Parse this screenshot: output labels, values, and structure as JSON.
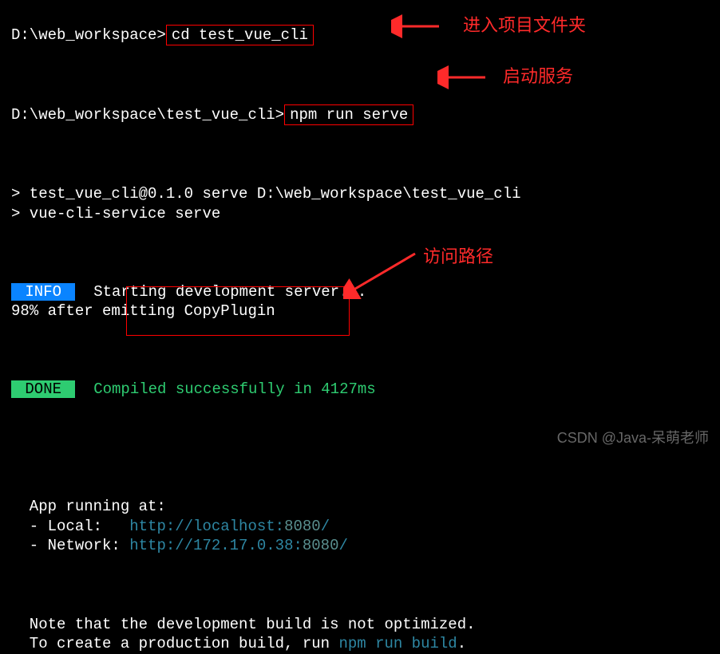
{
  "lines": {
    "l1_path": "D:\\web_workspace>",
    "l1_cmd": "cd test_vue_cli",
    "l2_path": "D:\\web_workspace\\test_vue_cli>",
    "l2_cmd": "npm run serve",
    "l3": "> test_vue_cli@0.1.0 serve D:\\web_workspace\\test_vue_cli",
    "l4": "> vue-cli-service serve",
    "info_label": " INFO ",
    "info_msg": "  Starting development server...",
    "progress": "98% after emitting CopyPlugin",
    "done_label": " DONE ",
    "done_msg": "  Compiled successfully in 4127ms",
    "app_run": "  App running at:",
    "local_label": "  - Local:   ",
    "local_url_pref": "http://localhost:",
    "local_port": "8080",
    "local_slash": "/",
    "network_label": "  - Network: ",
    "network_url_pref": "http://172.17.0.38:",
    "network_port": "8080",
    "network_slash": "/",
    "note1": "  Note that the development build is not optimized.",
    "note2a": "  To create a production build, run ",
    "note2b": "npm run build",
    "note2c": "."
  },
  "annotations": {
    "a1": "进入项目文件夹",
    "a2": "启动服务",
    "a3": "访问路径"
  },
  "watermark": "CSDN @Java-呆萌老师"
}
